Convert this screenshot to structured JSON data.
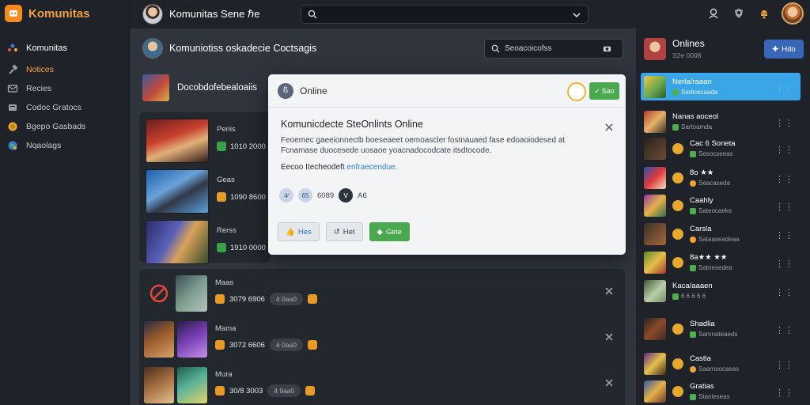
{
  "brand": {
    "name": "Komunitas"
  },
  "topbar": {
    "title": "Komunitas Sene",
    "title_suffix": "ℏe"
  },
  "sidebar": {
    "items": [
      {
        "label": "Komunitas",
        "icon": "group-icon"
      },
      {
        "label": "Notices",
        "icon": "hammer-icon"
      },
      {
        "label": "Recies",
        "icon": "mail-icon"
      },
      {
        "label": "Codoc Gratocs",
        "icon": "folder-icon"
      },
      {
        "label": "Bgepo Gasbads",
        "icon": "coin-icon"
      },
      {
        "label": "Nqaolags",
        "icon": "globe-icon"
      }
    ]
  },
  "main": {
    "header_title": "Komuniotiss oskadecie Coctsagis",
    "search_placeholder": "Seoacoicofss",
    "section_title": "Docobdofebealoaiis",
    "top_posts": [
      {
        "name": "Penis",
        "stat": "1010 2000"
      },
      {
        "name": "Geas",
        "stat": "1090 8600"
      },
      {
        "name": "Rerss",
        "stat": "1910 0000"
      }
    ],
    "cards": [
      {
        "name": "Maas",
        "stat": "3079 6906",
        "pill": "4 0aa0"
      },
      {
        "name": "Mama",
        "stat": "3072 6606",
        "pill": "4 0aa0"
      },
      {
        "name": "Mura",
        "stat": "30/8 3003",
        "pill": "4 9aa0"
      }
    ]
  },
  "modal": {
    "title": "Online",
    "button_label": "Sao",
    "heading": "Komunicdecte SteOnlints Online",
    "body": "Feoemec gaeeionnectb boeseaeet oemoascler fostnauaed fase edoaoiodesed at Fcnamase duocesede uosaoe yoacnadocodcate itsdtocode.",
    "link_prefix": "Eecoo Itecheodeft",
    "link_text": "enfraecendue.",
    "reactions": {
      "r1": "4⁄",
      "r2": "65",
      "count": "6089",
      "r3": "ꓦ",
      "count2": "A6"
    },
    "actions": {
      "like": "Hes",
      "reply": "Het",
      "share": "Geie"
    }
  },
  "right_panel": {
    "title": "Onlines",
    "subtitle": "S2e 0008",
    "button_label": "Hdo",
    "friends": [
      {
        "name": "Nerla/raaan",
        "status": "Sedicecaada",
        "active": true
      },
      {
        "name": "Nanas aoceol",
        "status": "Sartoamda",
        "active": false
      },
      {
        "name": "Cac 6 Soneta",
        "status": "Sesocseeas",
        "active": false
      },
      {
        "name": "8o ★★",
        "status": "Seacaseda",
        "active": false
      },
      {
        "name": "Caahly",
        "status": "Sateocaeke",
        "active": false
      },
      {
        "name": "Carsla",
        "status": "Sataaseadeaa",
        "active": false
      },
      {
        "name": "8a★★ ★★",
        "status": "Satnesedea",
        "active": false
      },
      {
        "name": "Kaca/aaaen",
        "status": "6 6 6 6 6",
        "active": false
      },
      {
        "name": "Shadlia",
        "status": "Samnateaeds",
        "active": false
      },
      {
        "name": "Castla",
        "status": "Saarnsocaeas",
        "active": false
      },
      {
        "name": "Gratias",
        "status": "Stanieseas",
        "active": false
      }
    ]
  },
  "colors": {
    "accent": "#f5a23a",
    "primary_blue": "#3a66b7",
    "active_row": "#3aa6e8",
    "green": "#4aa84e"
  }
}
